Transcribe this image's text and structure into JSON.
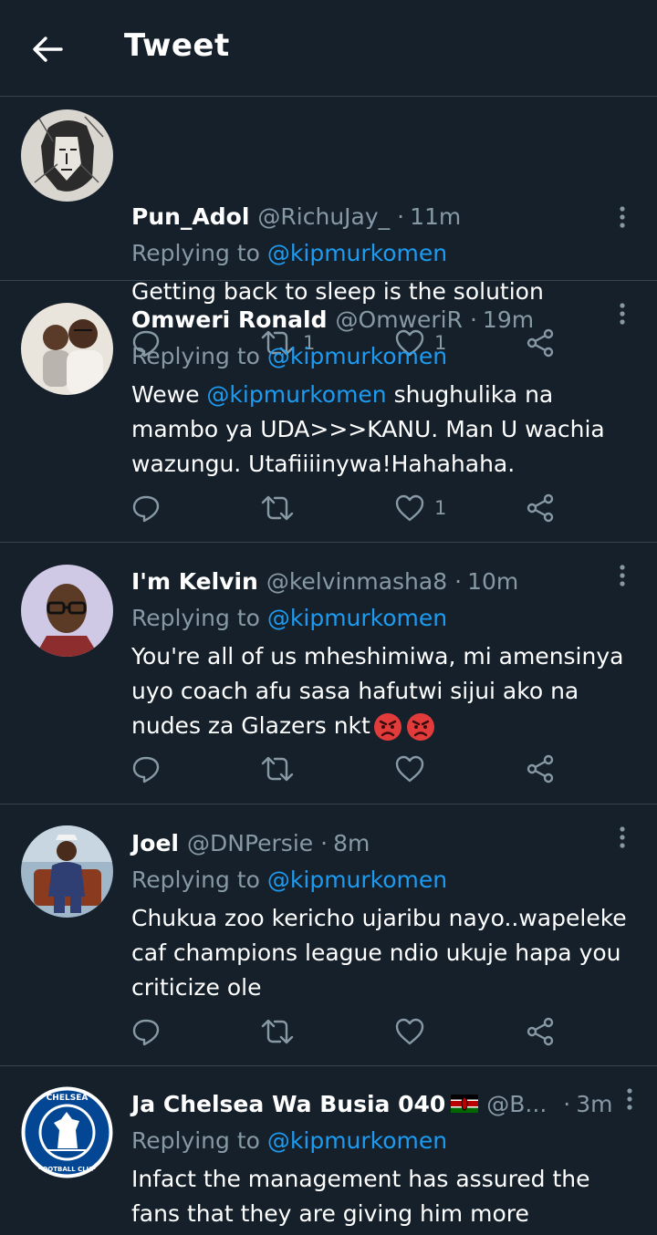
{
  "header": {
    "title": "Tweet"
  },
  "reply_prefix": "Replying to",
  "tweets": [
    {
      "name": "Pun_Adol",
      "handle": "@RichuJay_",
      "sep": "·",
      "time": "11m",
      "replying_to": "@kipmurkomen",
      "text": "Getting back to sleep is the solution",
      "retweets": "1",
      "likes": "1"
    },
    {
      "name": "Omweri Ronald",
      "handle": "@OmweriR",
      "sep": "·",
      "time": "19m",
      "replying_to": "@kipmurkomen",
      "text_before": "Wewe ",
      "text_mention": "@kipmurkomen",
      "text_after": " shughulika na mambo ya UDA>>>KANU. Man U wachia wazungu. Utafiiiinywa!Hahahaha.",
      "retweets": "",
      "likes": "1"
    },
    {
      "name": "I'm Kelvin",
      "handle": "@kelvinmasha8",
      "sep": "·",
      "time": "10m",
      "replying_to": "@kipmurkomen",
      "text": "You're all of us mheshimiwa, mi amensinya uyo coach afu sasa hafutwi sijui ako na nudes za Glazers nkt",
      "retweets": "",
      "likes": ""
    },
    {
      "name": "Joel",
      "handle": "@DNPersie",
      "sep": "·",
      "time": "8m",
      "replying_to": "@kipmurkomen",
      "text": "Chukua zoo kericho  ujaribu nayo..wapeleke caf champions league ndio ukuje hapa you criticize ole",
      "retweets": "",
      "likes": ""
    },
    {
      "name": "Ja Chelsea Wa Busia 040",
      "handle": "@B...",
      "sep": "·",
      "time": "3m",
      "replying_to": "@kipmurkomen",
      "text": "Infact the management has assured the fans that they are giving him more",
      "retweets": "",
      "likes": "",
      "badge_text_top": "CHELSEA",
      "badge_text_bottom": "FOOTBALL CLUB"
    }
  ]
}
